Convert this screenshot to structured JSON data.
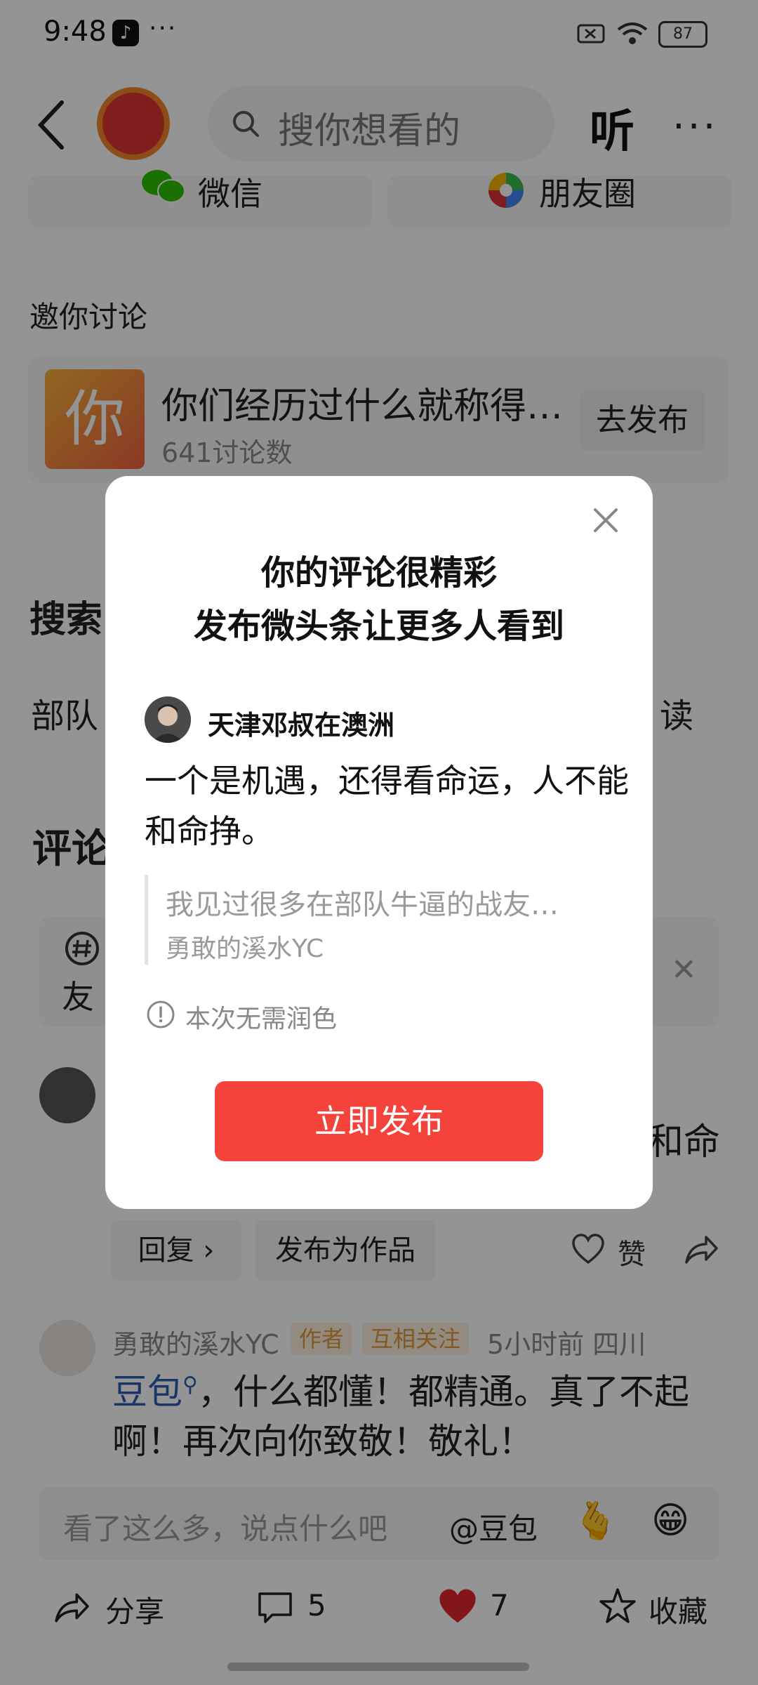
{
  "status_bar": {
    "time": "9:48",
    "app_glyph": "♪",
    "more_dots": "···",
    "battery": "87"
  },
  "header": {
    "search_placeholder": "搜你想看的",
    "listen_label": "听",
    "more": "···"
  },
  "share": {
    "wechat": "微信",
    "moments": "朋友圈"
  },
  "invite": {
    "title": "邀你讨论",
    "thumb_char": "你",
    "topic": "你们经历过什么就称得…",
    "count": "641讨论数",
    "go_publish": "去发布"
  },
  "background": {
    "search_heading_partial": "搜索",
    "related_left_partial": "部队",
    "related_right_partial": "读",
    "comment_heading_partial": "评论",
    "topic_friend_partial": "友",
    "comment1_tail": "和命"
  },
  "comment_actions": {
    "reply": "回复 ›",
    "publish_as_work": "发布为作品",
    "like": "赞"
  },
  "comment2": {
    "username": "勇敢的溪水YC",
    "badge_author": "作者",
    "badge_mutual": "互相关注",
    "meta": "5小时前  四川",
    "link": "豆包",
    "text": "，什么都懂！都精通。真了不起啊！再次向你致敬！敬礼！"
  },
  "input_bar": {
    "placeholder": "看了这么多，说点什么吧",
    "at_label": "@豆包",
    "emoji1": "🫰",
    "emoji2": "😁"
  },
  "bottom_bar": {
    "share": "分享",
    "comments": "5",
    "likes": "7",
    "favorite": "收藏"
  },
  "modal": {
    "title_line1": "你的评论很精彩",
    "title_line2": "发布微头条让更多人看到",
    "username": "天津邓叔在澳洲",
    "comment": "一个是机遇，还得看命运，人不能和命挣。",
    "quote_text": "我见过很多在部队牛逼的战友…",
    "quote_author": "勇敢的溪水YC",
    "info": "本次无需润色",
    "publish_button": "立即发布"
  },
  "colors": {
    "accent_red": "#f5433b",
    "link_blue": "#2a5db0",
    "badge_orange": "#e09a3a"
  }
}
